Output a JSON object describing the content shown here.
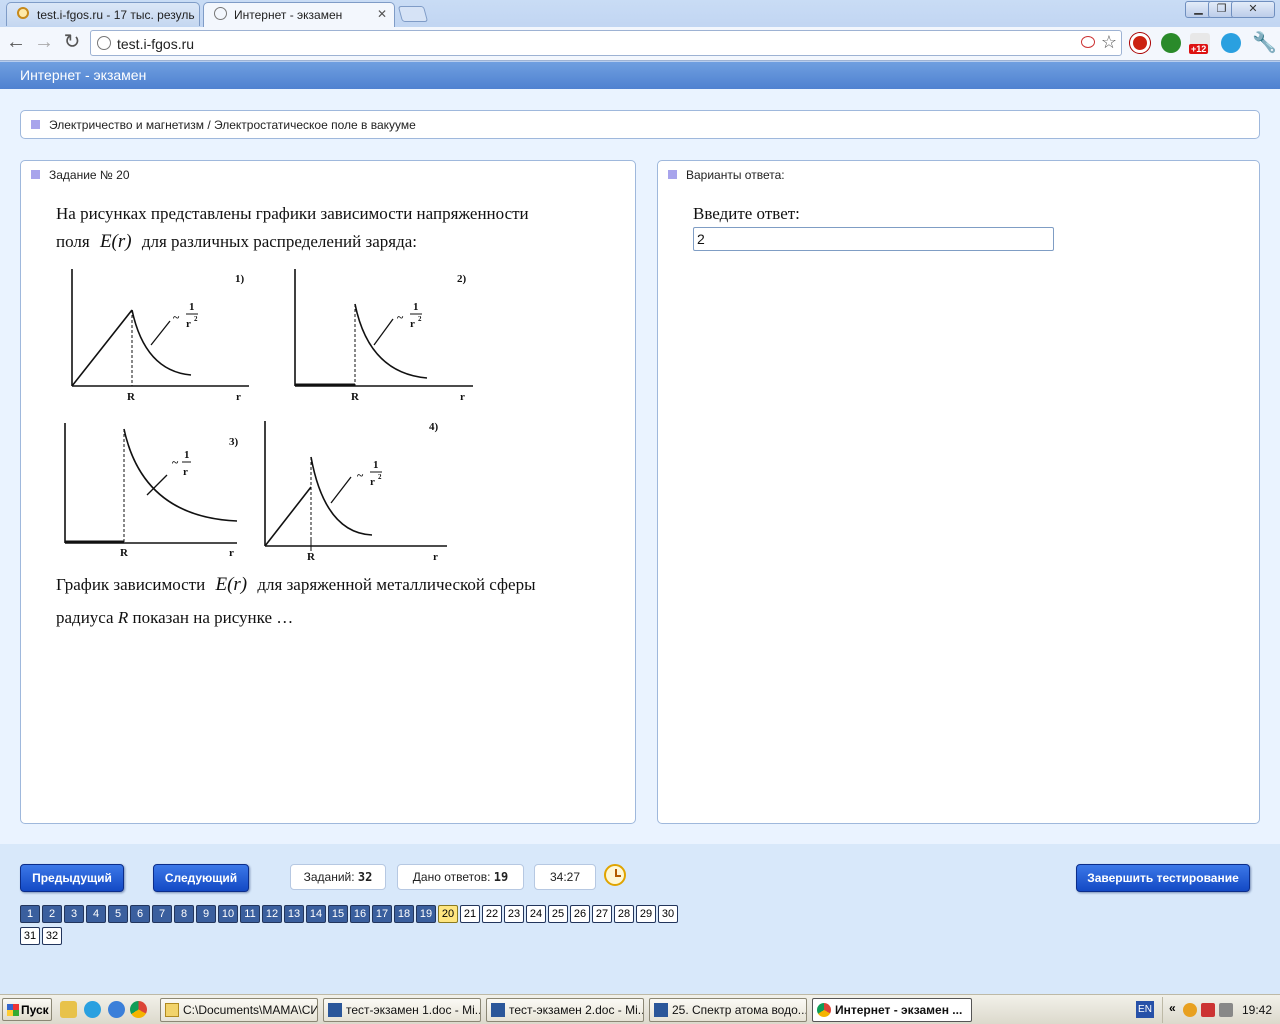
{
  "browser": {
    "tabs": [
      {
        "label": "test.i-fgos.ru - 17 тыс. резуль",
        "active": false
      },
      {
        "label": "Интернет - экзамен",
        "active": true
      }
    ],
    "url": "test.i-fgos.ru",
    "extension_badge": "+12"
  },
  "app": {
    "header_title": "Интернет - экзамен",
    "breadcrumb": "Электричество и магнетизм / Электростатическое поле в вакууме",
    "task": {
      "title": "Задание № 20",
      "intro_line1": "На рисунках представлены графики зависимости напряженности",
      "intro_line2_pre": "поля",
      "intro_line2_post": "для различных распределений заряда:",
      "formula": "E(r)",
      "question_line1_pre": "График зависимости",
      "question_line1_post": "для заряженной металлической сферы",
      "question_line2_pre": "радиуса",
      "question_line2_var": "R",
      "question_line2_post": "показан на рисунке …"
    },
    "graph_labels": {
      "num1": "1)",
      "num2": "2)",
      "num3": "3)",
      "num4": "4)",
      "axis_r": "r",
      "axis_R": "R",
      "tilde": "~",
      "numerator": "1",
      "denom_r2": "r",
      "exp2": "2",
      "denom_r": "r"
    },
    "answer": {
      "panel_title": "Варианты ответа:",
      "label": "Введите ответ:",
      "value": "2"
    },
    "controls": {
      "prev": "Предыдущий",
      "next": "Следующий",
      "tasks_label": "Заданий:",
      "tasks_count": "32",
      "answers_label": "Дано ответов:",
      "answers_count": "19",
      "timer": "34:27",
      "finish": "Завершить тестирование"
    },
    "questions": {
      "current": 20,
      "answered_through": 19,
      "row1": [
        "1",
        "2",
        "3",
        "4",
        "5",
        "6",
        "7",
        "8",
        "9",
        "10",
        "11",
        "12",
        "13",
        "14",
        "15",
        "16",
        "17",
        "18",
        "19",
        "20",
        "21",
        "22",
        "23",
        "24",
        "25",
        "26",
        "27",
        "28",
        "29",
        "30"
      ],
      "row2": [
        "31",
        "32"
      ]
    }
  },
  "taskbar": {
    "start": "Пуск",
    "tasks": [
      {
        "label": "C:\\Documents\\МАМА\\СИ...",
        "active": false
      },
      {
        "label": "тест-экзамен 1.doc - Mi...",
        "active": false
      },
      {
        "label": "тест-экзамен 2.doc - Mi...",
        "active": false
      },
      {
        "label": "25. Спектр атома водо...",
        "active": false
      },
      {
        "label": "Интернет - экзамен ...",
        "active": true
      }
    ],
    "lang": "EN",
    "clock": "19:42",
    "chevron": "«"
  },
  "colors": {
    "app_header": "#4f81d0",
    "button_blue": "#1349c4",
    "answered": "#3a5f9e",
    "current": "#ffe680"
  }
}
